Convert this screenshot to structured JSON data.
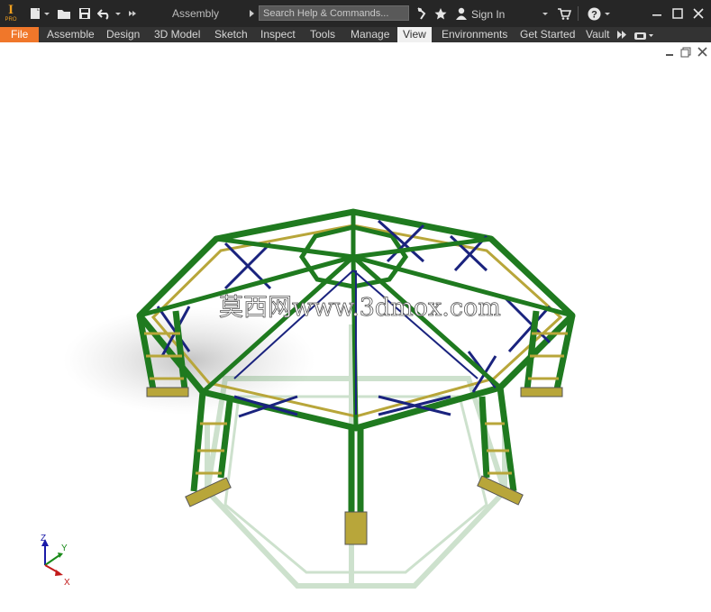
{
  "app": {
    "logo_letter": "I",
    "logo_sub": "PRO",
    "document_title": "Assembly",
    "search_placeholder": "Search Help & Commands...",
    "sign_in": "Sign In"
  },
  "ribbon_tabs": [
    "File",
    "Assemble",
    "Design",
    "3D Model",
    "Sketch",
    "Inspect",
    "Tools",
    "Manage",
    "View",
    "Environments",
    "Get Started",
    "Vault"
  ],
  "active_tab": "View",
  "viewport": {
    "watermark": "莫西网www.3dmox.com",
    "triad": {
      "x": "X",
      "y": "Y",
      "z": "Z"
    }
  },
  "colors": {
    "frame_green": "#1f7a1f",
    "brace_blue": "#1a237e",
    "brace_yellow": "#b8a63a",
    "file_tab": "#f0772a"
  }
}
